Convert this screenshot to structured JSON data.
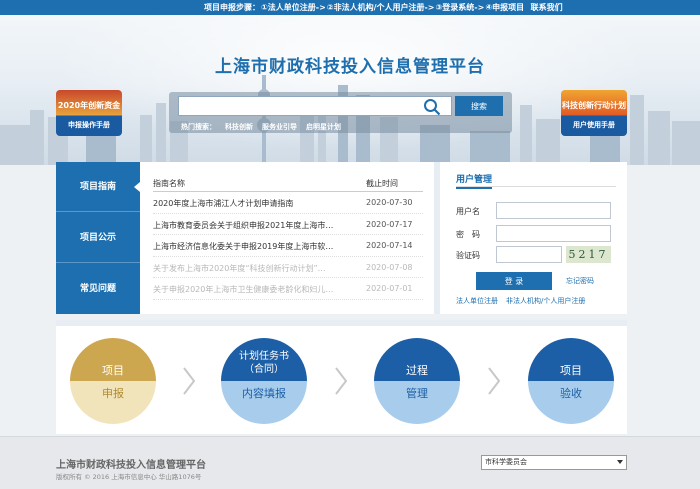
{
  "topbar": {
    "label": "项目申报步骤：",
    "steps": [
      "①法人单位注册->",
      "②非法人机构/个人用户注册->",
      "③登录系统->",
      "④申报项目"
    ],
    "contact": "联系我们"
  },
  "header": {
    "title": "上海市财政科技投入信息管理平台"
  },
  "badges": {
    "left": {
      "line1": "2020年创新资金",
      "line2": "申报操作手册"
    },
    "right": {
      "line1": "科技创新行动计划",
      "line2": "用户使用手册"
    }
  },
  "search": {
    "button": "搜索",
    "hot_label": "热门搜索：",
    "hot_items": [
      "科技创新",
      "服务业引导",
      "启明星计划"
    ]
  },
  "nav": {
    "items": [
      "项目指南",
      "项目公示",
      "常见问题"
    ]
  },
  "guide_list": {
    "col_name": "指南名称",
    "col_date": "截止时间",
    "rows": [
      {
        "title": "2020年度上海市浦江人才计划申请指南",
        "date": "2020-07-30"
      },
      {
        "title": "上海市教育委员会关于组织申报2021年度上海市…",
        "date": "2020-07-17"
      },
      {
        "title": "上海市经济信息化委关于申报2019年度上海市软…",
        "date": "2020-07-14"
      },
      {
        "title": "关于发布上海市2020年度“科技创新行动计划”…",
        "date": "2020-07-08"
      },
      {
        "title": "关于申报2020年上海市卫生健康委老龄化和妇儿…",
        "date": "2020-07-01"
      }
    ]
  },
  "login": {
    "title": "用户管理",
    "username_label": "用户名",
    "password_label": "密　码",
    "captcha_label": "验证码",
    "captcha_text": "5217",
    "button": "登 录",
    "forgot": "忘记密码",
    "register_legal": "法人单位注册",
    "register_personal": "非法人机构/个人用户注册"
  },
  "process": {
    "steps": [
      {
        "top": "项目",
        "bottom": "申报",
        "style": "gold"
      },
      {
        "top": "计划任务书\n（合同）",
        "bottom": "内容填报",
        "style": "blue"
      },
      {
        "top": "过程",
        "bottom": "管理",
        "style": "blue"
      },
      {
        "top": "项目",
        "bottom": "验收",
        "style": "blue"
      }
    ]
  },
  "footer": {
    "title": "上海市财政科技投入信息管理平台",
    "copyright": "版权所有 © 2016 上海市信息中心 华山路1076号",
    "select_value": "市科学委员会"
  },
  "colors": {
    "primary": "#1d6fb0",
    "gold": "#cda74f",
    "faded_text": "#b8b8b8"
  }
}
